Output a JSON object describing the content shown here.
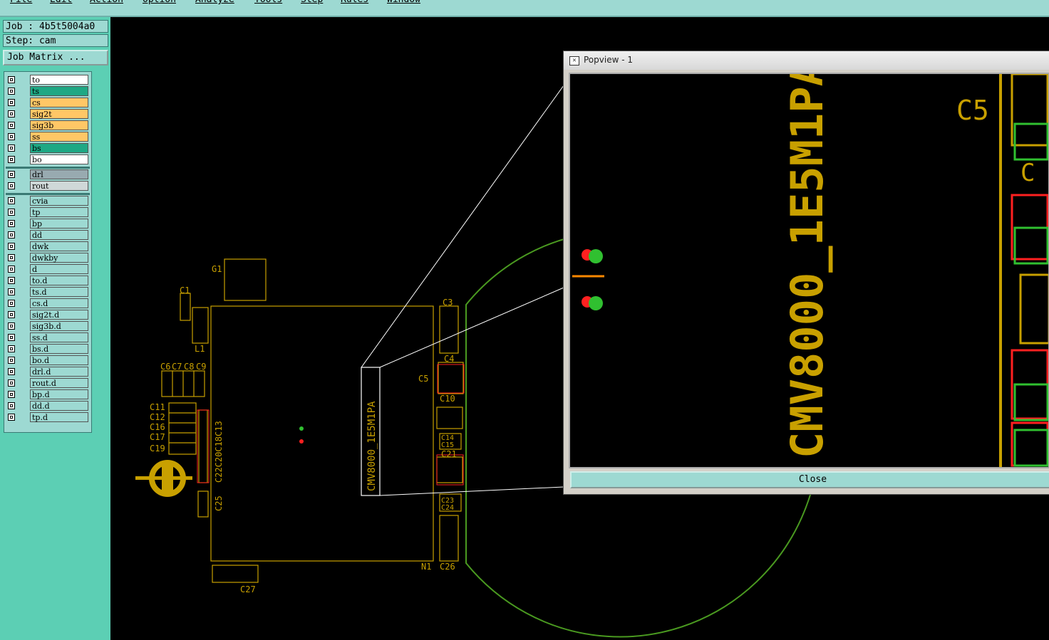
{
  "menu": [
    "File",
    "Edit",
    "Action",
    "Option",
    "Analyze",
    "Tools",
    "Step",
    "Rules",
    "Window"
  ],
  "job_label": "Job : 4b5t5004a0",
  "step_label": "Step: cam",
  "job_matrix_label": "Job Matrix ...",
  "layers_top": [
    {
      "name": "to",
      "color": "#ffffff"
    },
    {
      "name": "ts",
      "color": "#1ea884"
    },
    {
      "name": "cs",
      "color": "#ffc766"
    },
    {
      "name": "sig2t",
      "color": "#ffc766"
    },
    {
      "name": "sig3b",
      "color": "#ffc766"
    },
    {
      "name": "ss",
      "color": "#ffc766"
    },
    {
      "name": "bs",
      "color": "#1ea884"
    },
    {
      "name": "bo",
      "color": "#ffffff"
    }
  ],
  "layers_drill": [
    {
      "name": "drl",
      "color": "#98aab0"
    },
    {
      "name": "rout",
      "color": "#cfd8d8"
    }
  ],
  "layers_misc": [
    {
      "name": "cvia"
    },
    {
      "name": "tp"
    },
    {
      "name": "bp"
    },
    {
      "name": "dd"
    },
    {
      "name": "dwk"
    },
    {
      "name": "dwkby"
    },
    {
      "name": "d"
    },
    {
      "name": "to.d"
    },
    {
      "name": "ts.d"
    },
    {
      "name": "cs.d"
    },
    {
      "name": "sig2t.d"
    },
    {
      "name": "sig3b.d"
    },
    {
      "name": "ss.d"
    },
    {
      "name": "bs.d"
    },
    {
      "name": "bo.d"
    },
    {
      "name": "drl.d"
    },
    {
      "name": "rout.d"
    },
    {
      "name": "bp.d"
    },
    {
      "name": "dd.d"
    },
    {
      "name": "tp.d"
    }
  ],
  "board_labels": {
    "g1": "G1",
    "c1": "C1",
    "l1": "L1",
    "c3": "C3",
    "c4": "C4",
    "c5": "C5",
    "c10": "C10",
    "c6": "C6",
    "c7": "C7",
    "c8": "C8",
    "c9": "C9",
    "c11": "C11",
    "c12": "C12",
    "c16": "C16",
    "c17": "C17",
    "c19": "C19",
    "c_vert": "C22C20C18C13",
    "c25": "C25",
    "c14": "C14",
    "c15": "C15",
    "c21": "C21",
    "c23": "C23",
    "c24": "C24",
    "n1": "N1",
    "c26": "C26",
    "c27": "C27",
    "part": "CMV8000_1E5M1PA"
  },
  "popview": {
    "title": "Popview - 1",
    "part_label": "CMV8000_1E5M1PA",
    "c5": "C5",
    "c_partial": "C",
    "close_label": "Close"
  },
  "colors": {
    "silk": "#c8a000",
    "outline": "#4a9a20",
    "pad_red": "#ff2020",
    "pad_green": "#30c030"
  }
}
